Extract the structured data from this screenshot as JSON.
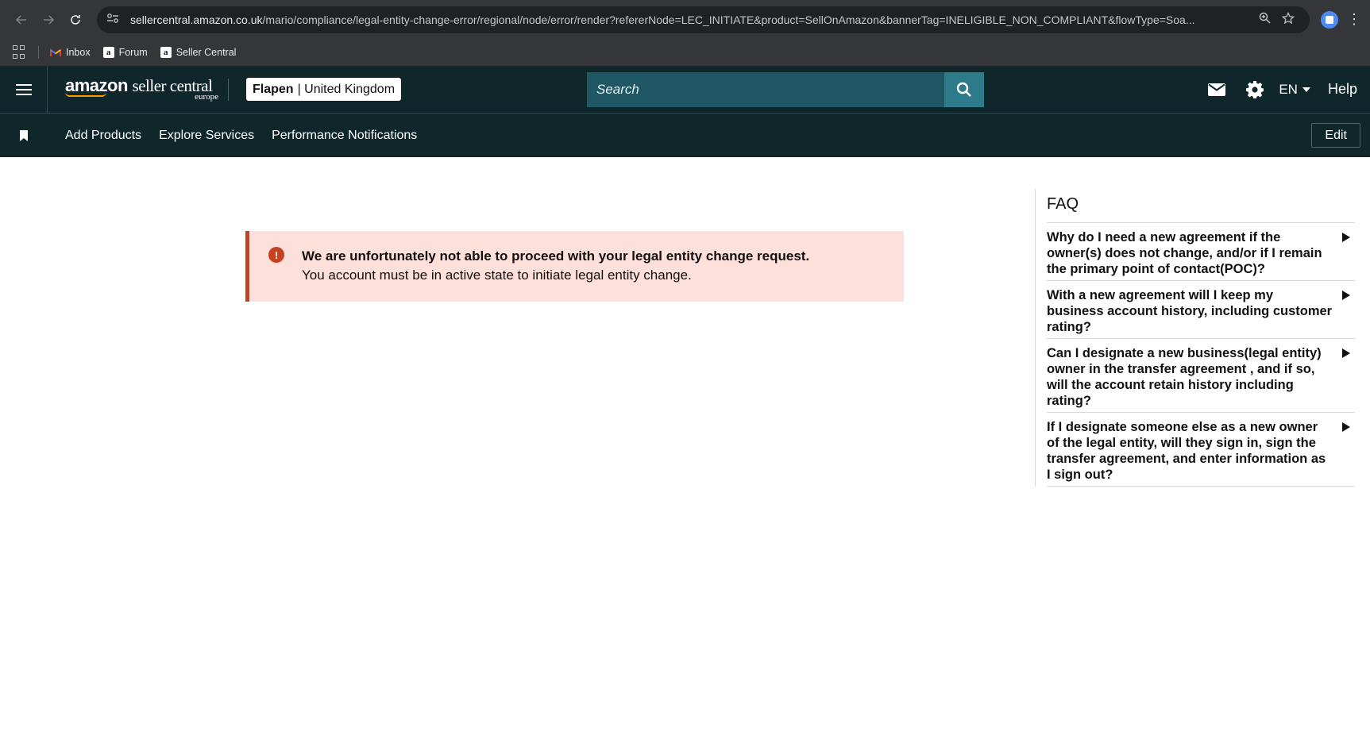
{
  "browser": {
    "url_host": "sellercentral.amazon.co.uk",
    "url_rest": "/mario/compliance/legal-entity-change-error/regional/node/error/render?refererNode=LEC_INITIATE&product=SellOnAmazon&bannerTag=INELIGIBLE_NON_COMPLIANT&flowType=Soa...",
    "bookmarks": [
      {
        "label": "Inbox",
        "icon": "gmail-icon"
      },
      {
        "label": "Forum",
        "icon": "amazon-icon"
      },
      {
        "label": "Seller Central",
        "icon": "amazon-icon"
      }
    ]
  },
  "header": {
    "logo_text": "amazon",
    "logo_sub": "seller central",
    "logo_region": "europe",
    "account_name": "Flapen",
    "account_sep": "|",
    "account_region": "United Kingdom",
    "search_placeholder": "Search",
    "language": "EN",
    "help": "Help"
  },
  "subnav": {
    "links": [
      "Add Products",
      "Explore Services",
      "Performance Notifications"
    ],
    "edit": "Edit"
  },
  "alert": {
    "icon_glyph": "!",
    "title": "We are unfortunately not able to proceed with your legal entity change request.",
    "message": "You account must be in active state to initiate legal entity change."
  },
  "faq": {
    "title": "FAQ",
    "items": [
      "Why do I need a new agreement if the owner(s) does not change, and/or if I remain the primary point of contact(POC)?",
      "With a new agreement will I keep my business account history, including customer rating?",
      "Can I designate a new business(legal entity) owner in the transfer agreement , and if so, will the account retain history including rating?",
      "If I designate someone else as a new owner of the legal entity, will they sign in, sign the transfer agreement, and enter information as I sign out?"
    ]
  },
  "colors": {
    "header_bg": "#0f262b",
    "search_bg": "#1f5765",
    "search_btn": "#2d7a8b",
    "alert_bg": "#fde0d9",
    "alert_accent": "#c7401f"
  }
}
